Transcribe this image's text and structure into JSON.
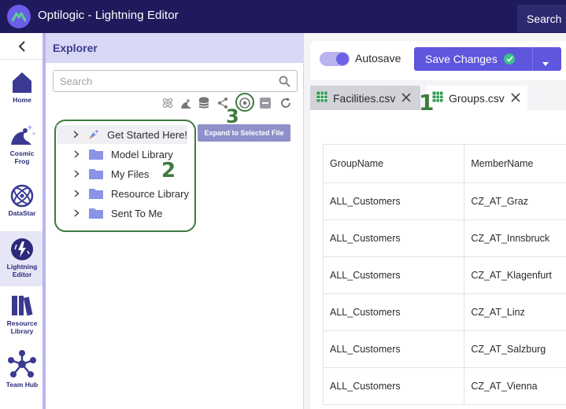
{
  "app": {
    "title": "Optilogic - Lightning Editor",
    "search_label": "Search"
  },
  "leftnav": {
    "items": [
      {
        "label": "Home",
        "icon": "home-icon"
      },
      {
        "label": "Cosmic Frog",
        "icon": "cosmic-frog-icon"
      },
      {
        "label": "DataStar",
        "icon": "datastar-icon"
      },
      {
        "label": "Lightning Editor",
        "icon": "lightning-icon"
      },
      {
        "label": "Resource Library",
        "icon": "books-icon"
      },
      {
        "label": "Team Hub",
        "icon": "team-hub-icon"
      }
    ]
  },
  "explorer": {
    "title": "Explorer",
    "search_placeholder": "Search",
    "tooltip": "Expand to Selected File",
    "tree": [
      {
        "label": "Get Started Here!",
        "icon": "rocket-icon"
      },
      {
        "label": "Model Library",
        "icon": "folder-icon"
      },
      {
        "label": "My Files",
        "icon": "folder-icon"
      },
      {
        "label": "Resource Library",
        "icon": "folder-icon"
      },
      {
        "label": "Sent To Me",
        "icon": "folder-icon"
      }
    ]
  },
  "annotations": {
    "one": "1",
    "two": "2",
    "three": "3"
  },
  "editor": {
    "autosave_label": "Autosave",
    "autosave_on": true,
    "save_label": "Save Changes",
    "tabs": [
      {
        "label": "Facilities.csv",
        "active": false
      },
      {
        "label": "Groups.csv",
        "active": true
      }
    ],
    "grid": {
      "headers": [
        "GroupName",
        "MemberName"
      ],
      "rows": [
        [
          "ALL_Customers",
          "CZ_AT_Graz"
        ],
        [
          "ALL_Customers",
          "CZ_AT_Innsbruck"
        ],
        [
          "ALL_Customers",
          "CZ_AT_Klagenfurt"
        ],
        [
          "ALL_Customers",
          "CZ_AT_Linz"
        ],
        [
          "ALL_Customers",
          "CZ_AT_Salzburg"
        ],
        [
          "ALL_Customers",
          "CZ_AT_Vienna"
        ]
      ]
    }
  },
  "colors": {
    "topbar": "#1f1a5c",
    "accent": "#5e56dd",
    "annotation": "#3e7a3e",
    "explorer_header": "#d8d7f6"
  }
}
